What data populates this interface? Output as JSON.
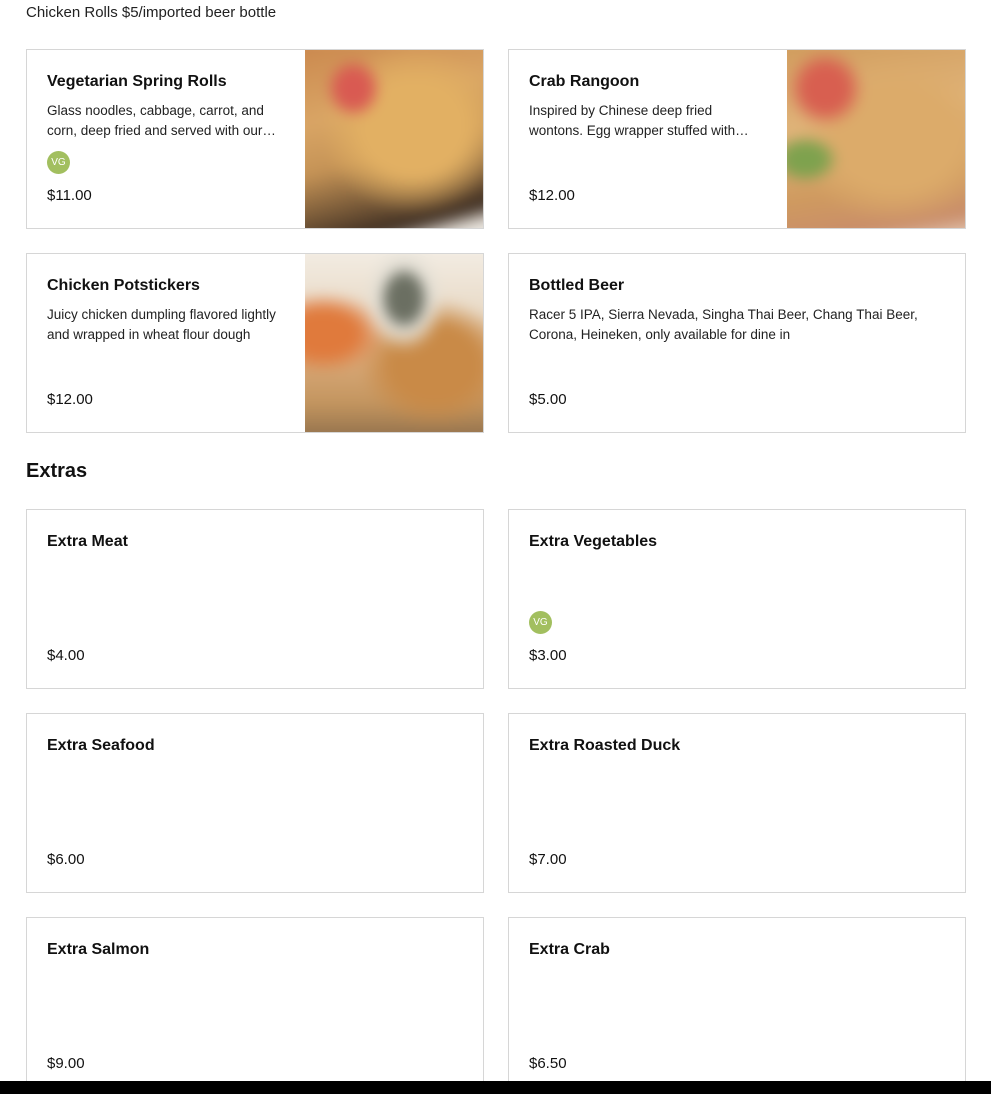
{
  "top_note": "Chicken Rolls $5/imported beer bottle",
  "appetizers": [
    {
      "title": "Vegetarian Spring Rolls",
      "description": "Glass noodles, cabbage, carrot, and corn, deep fried and served with our house sweet chili sauce",
      "badge": "VG",
      "price": "$11.00",
      "image": "spring-rolls-photo"
    },
    {
      "title": "Crab Rangoon",
      "description": "Inspired by Chinese deep fried wontons. Egg wrapper stuffed with imitation crab and cream cheese",
      "badge": "",
      "price": "$12.00",
      "image": "crab-rangoon-photo"
    },
    {
      "title": "Chicken Potstickers",
      "description": "Juicy chicken dumpling flavored lightly and wrapped in wheat flour dough",
      "badge": "",
      "price": "$12.00",
      "image": "potstickers-photo"
    },
    {
      "title": "Bottled Beer",
      "description": "Racer 5 IPA, Sierra Nevada, Singha Thai Beer, Chang Thai Beer, Corona, Heineken, only available for dine in",
      "badge": "",
      "price": "$5.00",
      "image": ""
    }
  ],
  "extras_section": {
    "title": "Extras",
    "items": [
      {
        "title": "Extra Meat",
        "badge": "",
        "price": "$4.00"
      },
      {
        "title": "Extra Vegetables",
        "badge": "VG",
        "price": "$3.00"
      },
      {
        "title": "Extra Seafood",
        "badge": "",
        "price": "$6.00"
      },
      {
        "title": "Extra Roasted Duck",
        "badge": "",
        "price": "$7.00"
      },
      {
        "title": "Extra Salmon",
        "badge": "",
        "price": "$9.00"
      },
      {
        "title": "Extra Crab",
        "badge": "",
        "price": "$6.50"
      }
    ]
  },
  "colors": {
    "vegan_badge": "#a2bf5f",
    "card_border": "#d6d6d6"
  }
}
